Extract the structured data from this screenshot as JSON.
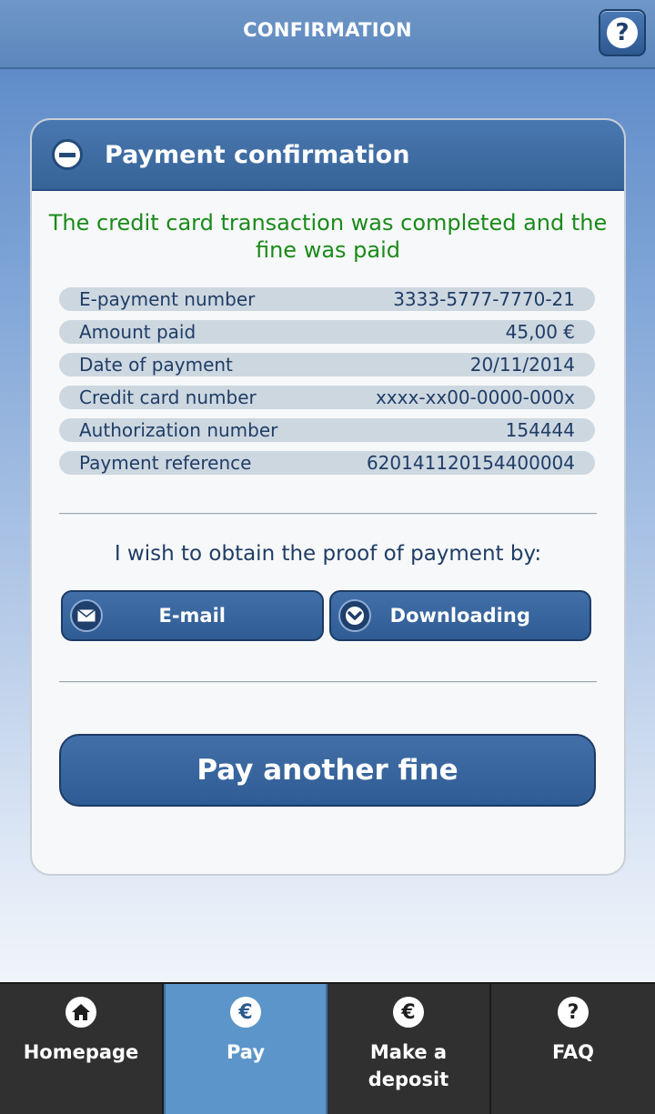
{
  "header": {
    "title": "CONFIRMATION",
    "help_icon": "help-icon"
  },
  "card": {
    "title": "Payment confirmation",
    "success_message": "The credit card transaction was completed and the fine was paid",
    "details": [
      {
        "label": "E-payment number",
        "value": "3333-5777-7770-21"
      },
      {
        "label": "Amount paid",
        "value": "45,00 €"
      },
      {
        "label": "Date of payment",
        "value": "20/11/2014"
      },
      {
        "label": "Credit card number",
        "value": "xxxx-xx00-0000-000x"
      },
      {
        "label": "Authorization number",
        "value": "154444"
      },
      {
        "label": "Payment reference",
        "value": "620141120154400004"
      }
    ],
    "proof_prompt": "I wish to obtain the proof of payment by:",
    "email_label": "E-mail",
    "download_label": "Downloading",
    "pay_another_label": "Pay another fine"
  },
  "nav": [
    {
      "label": "Homepage",
      "icon": "home-icon",
      "active": false
    },
    {
      "label": "Pay",
      "icon": "euro-icon",
      "active": true
    },
    {
      "label": "Make a deposit",
      "icon": "euro-icon",
      "active": false
    },
    {
      "label": "FAQ",
      "icon": "help-icon",
      "active": false
    }
  ],
  "colors": {
    "accent": "#3a679f",
    "success": "#1a8a1a",
    "active_tab": "#5b95c9"
  }
}
